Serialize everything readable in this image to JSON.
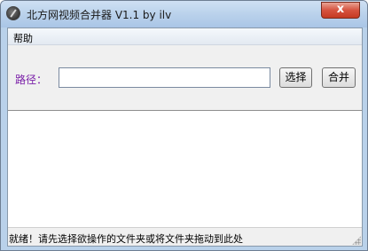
{
  "window": {
    "title": "北方网视频合并器 V1.1 by ilv",
    "close_label": "x"
  },
  "menu": {
    "items": [
      {
        "label": "帮助"
      }
    ]
  },
  "form": {
    "path_label": "路径：",
    "path_value": "",
    "select_button": "选择",
    "merge_button": "合并"
  },
  "status": {
    "text": "就绪！请先选择欲操作的文件夹或将文件夹拖动到此处"
  },
  "colors": {
    "path_label": "#7a1fa8",
    "title_bar": "#bcd3ec",
    "close_button": "#c53a22"
  }
}
